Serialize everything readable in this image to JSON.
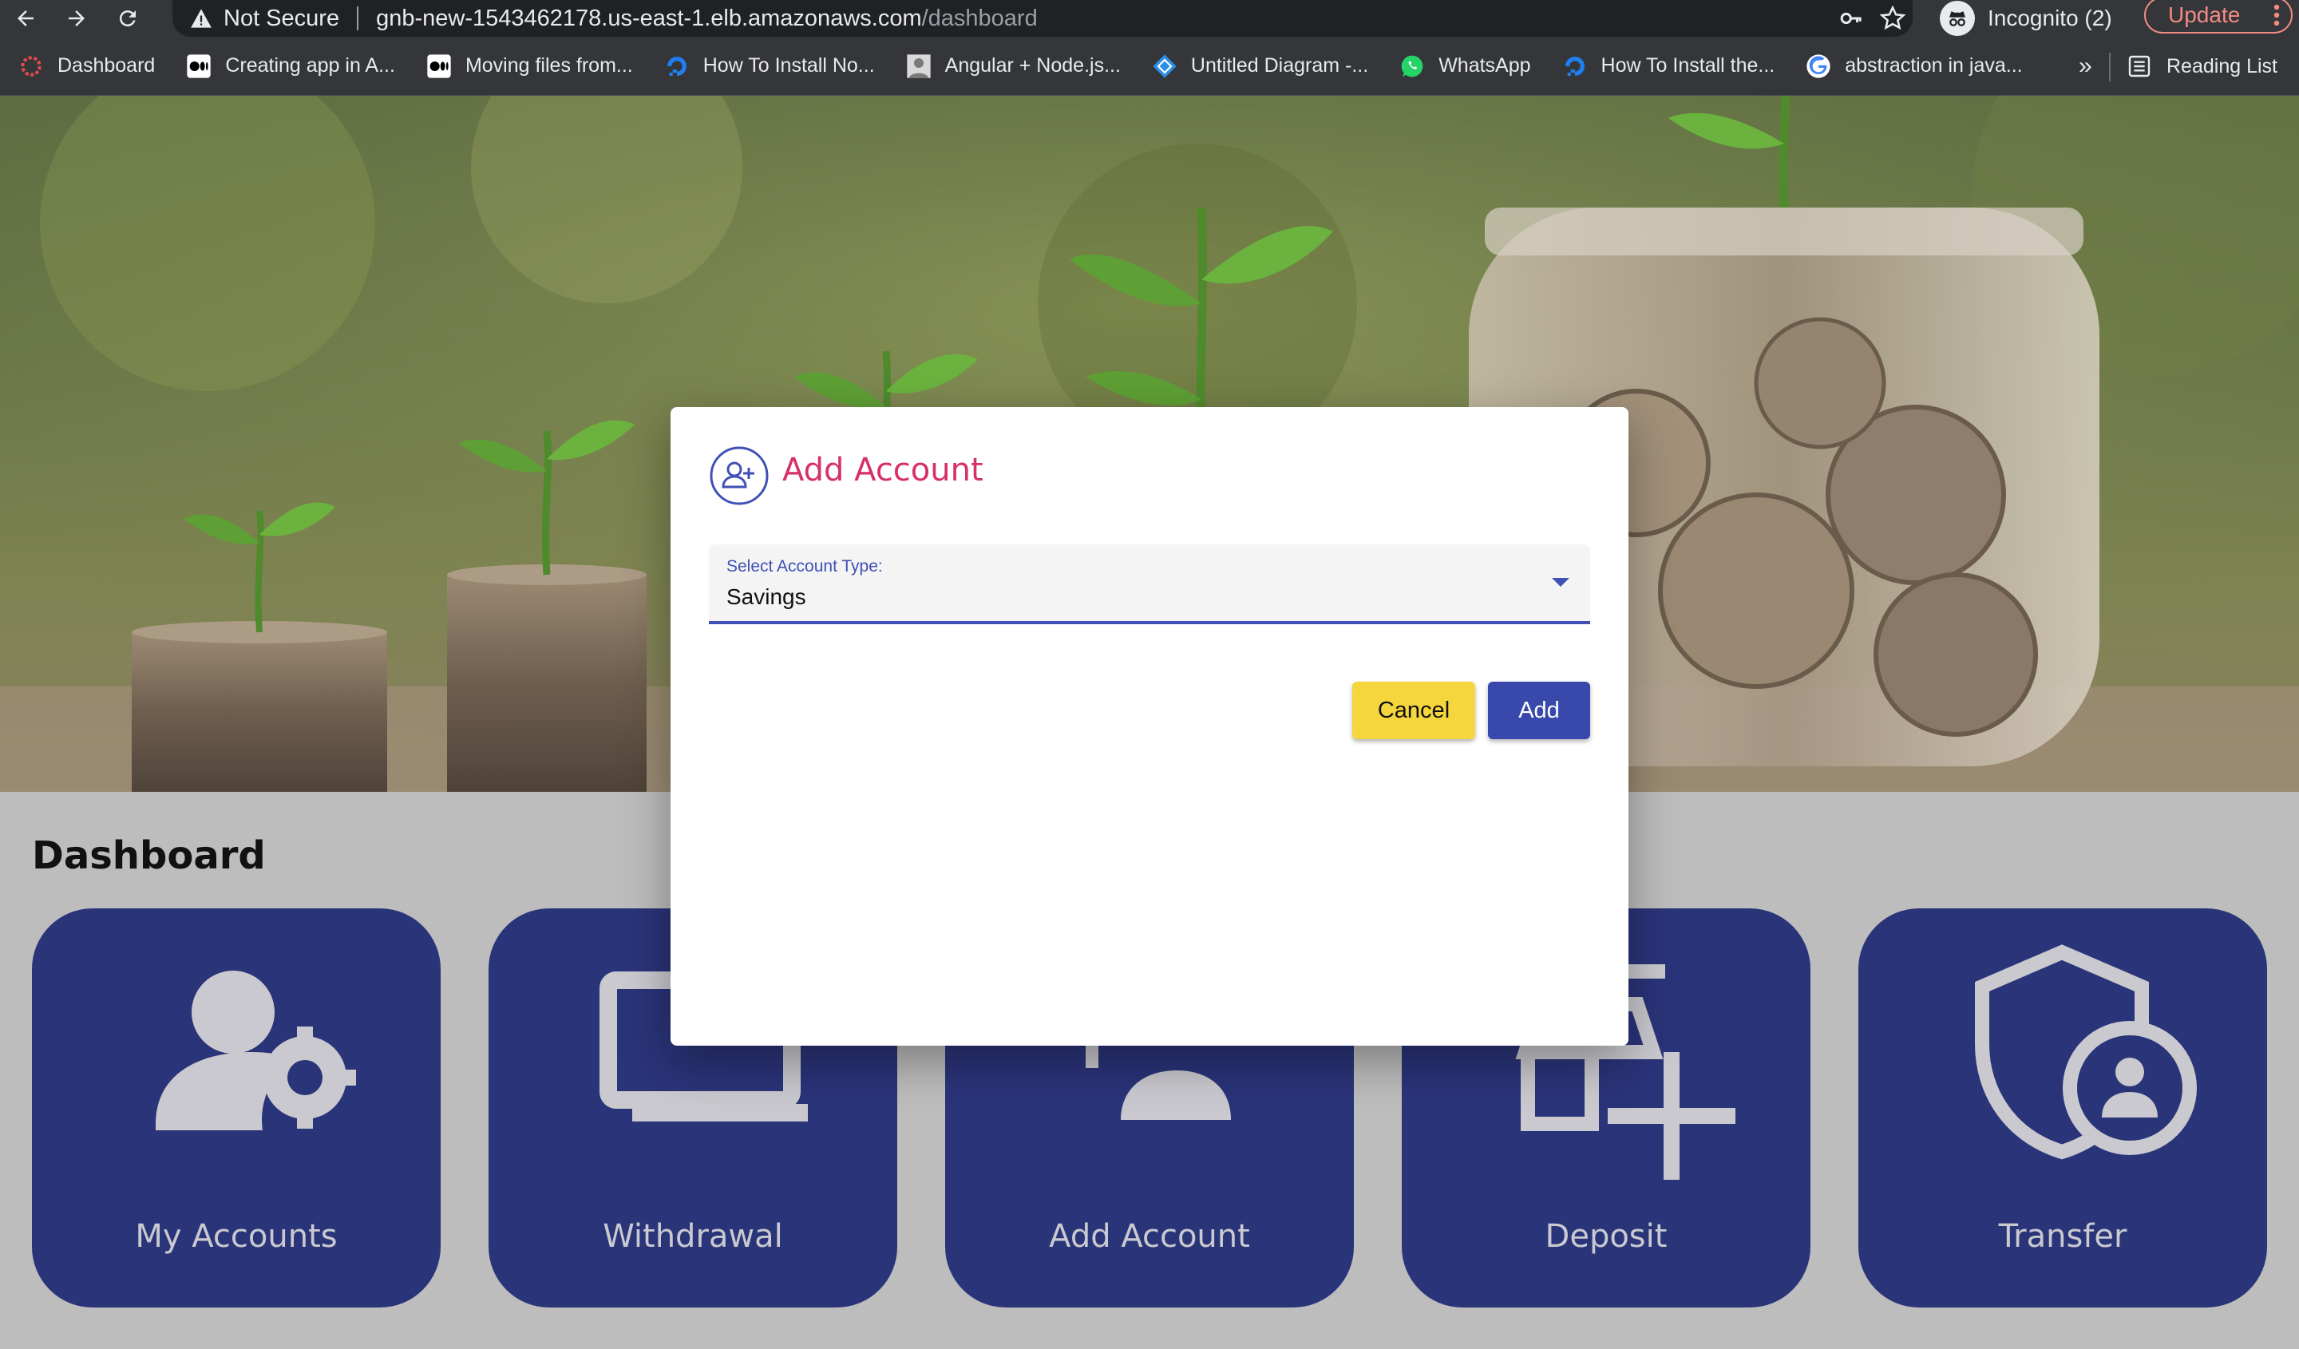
{
  "browser": {
    "security_label": "Not Secure",
    "url_host": "gnb-new-1543462178.us-east-1.elb.amazonaws.com",
    "url_path": "/dashboard",
    "profile_label": "Incognito (2)",
    "update_label": "Update",
    "bookmarks": [
      {
        "label": "Dashboard",
        "icon": "app-gear-icon"
      },
      {
        "label": "Creating app in A...",
        "icon": "medium-icon"
      },
      {
        "label": "Moving files from...",
        "icon": "medium-icon"
      },
      {
        "label": "How To Install No...",
        "icon": "digitalocean-icon"
      },
      {
        "label": "Angular + Node.js...",
        "icon": "avatar-icon"
      },
      {
        "label": "Untitled Diagram -...",
        "icon": "drawio-icon"
      },
      {
        "label": "WhatsApp",
        "icon": "whatsapp-icon"
      },
      {
        "label": "How To Install the...",
        "icon": "digitalocean-icon"
      },
      {
        "label": "abstraction in java...",
        "icon": "google-icon"
      }
    ],
    "more_label": "»",
    "reading_list_label": "Reading List"
  },
  "page": {
    "title": "Dashboard",
    "cards": [
      {
        "label": "My Accounts",
        "icon": "user-settings-icon"
      },
      {
        "label": "Withdrawal",
        "icon": "computer-icon"
      },
      {
        "label": "Add Account",
        "icon": "person-add-icon"
      },
      {
        "label": "Deposit",
        "icon": "add-business-icon"
      },
      {
        "label": "Transfer",
        "icon": "admin-shield-icon"
      }
    ]
  },
  "dialog": {
    "title": "Add Account",
    "field_label": "Select Account Type:",
    "field_value": "Savings",
    "cancel_label": "Cancel",
    "add_label": "Add"
  },
  "colors": {
    "accent": "#3f51b5",
    "title_pink": "#d6306a",
    "cancel_yellow": "#f6d63d",
    "card_navy": "#2a3479"
  }
}
